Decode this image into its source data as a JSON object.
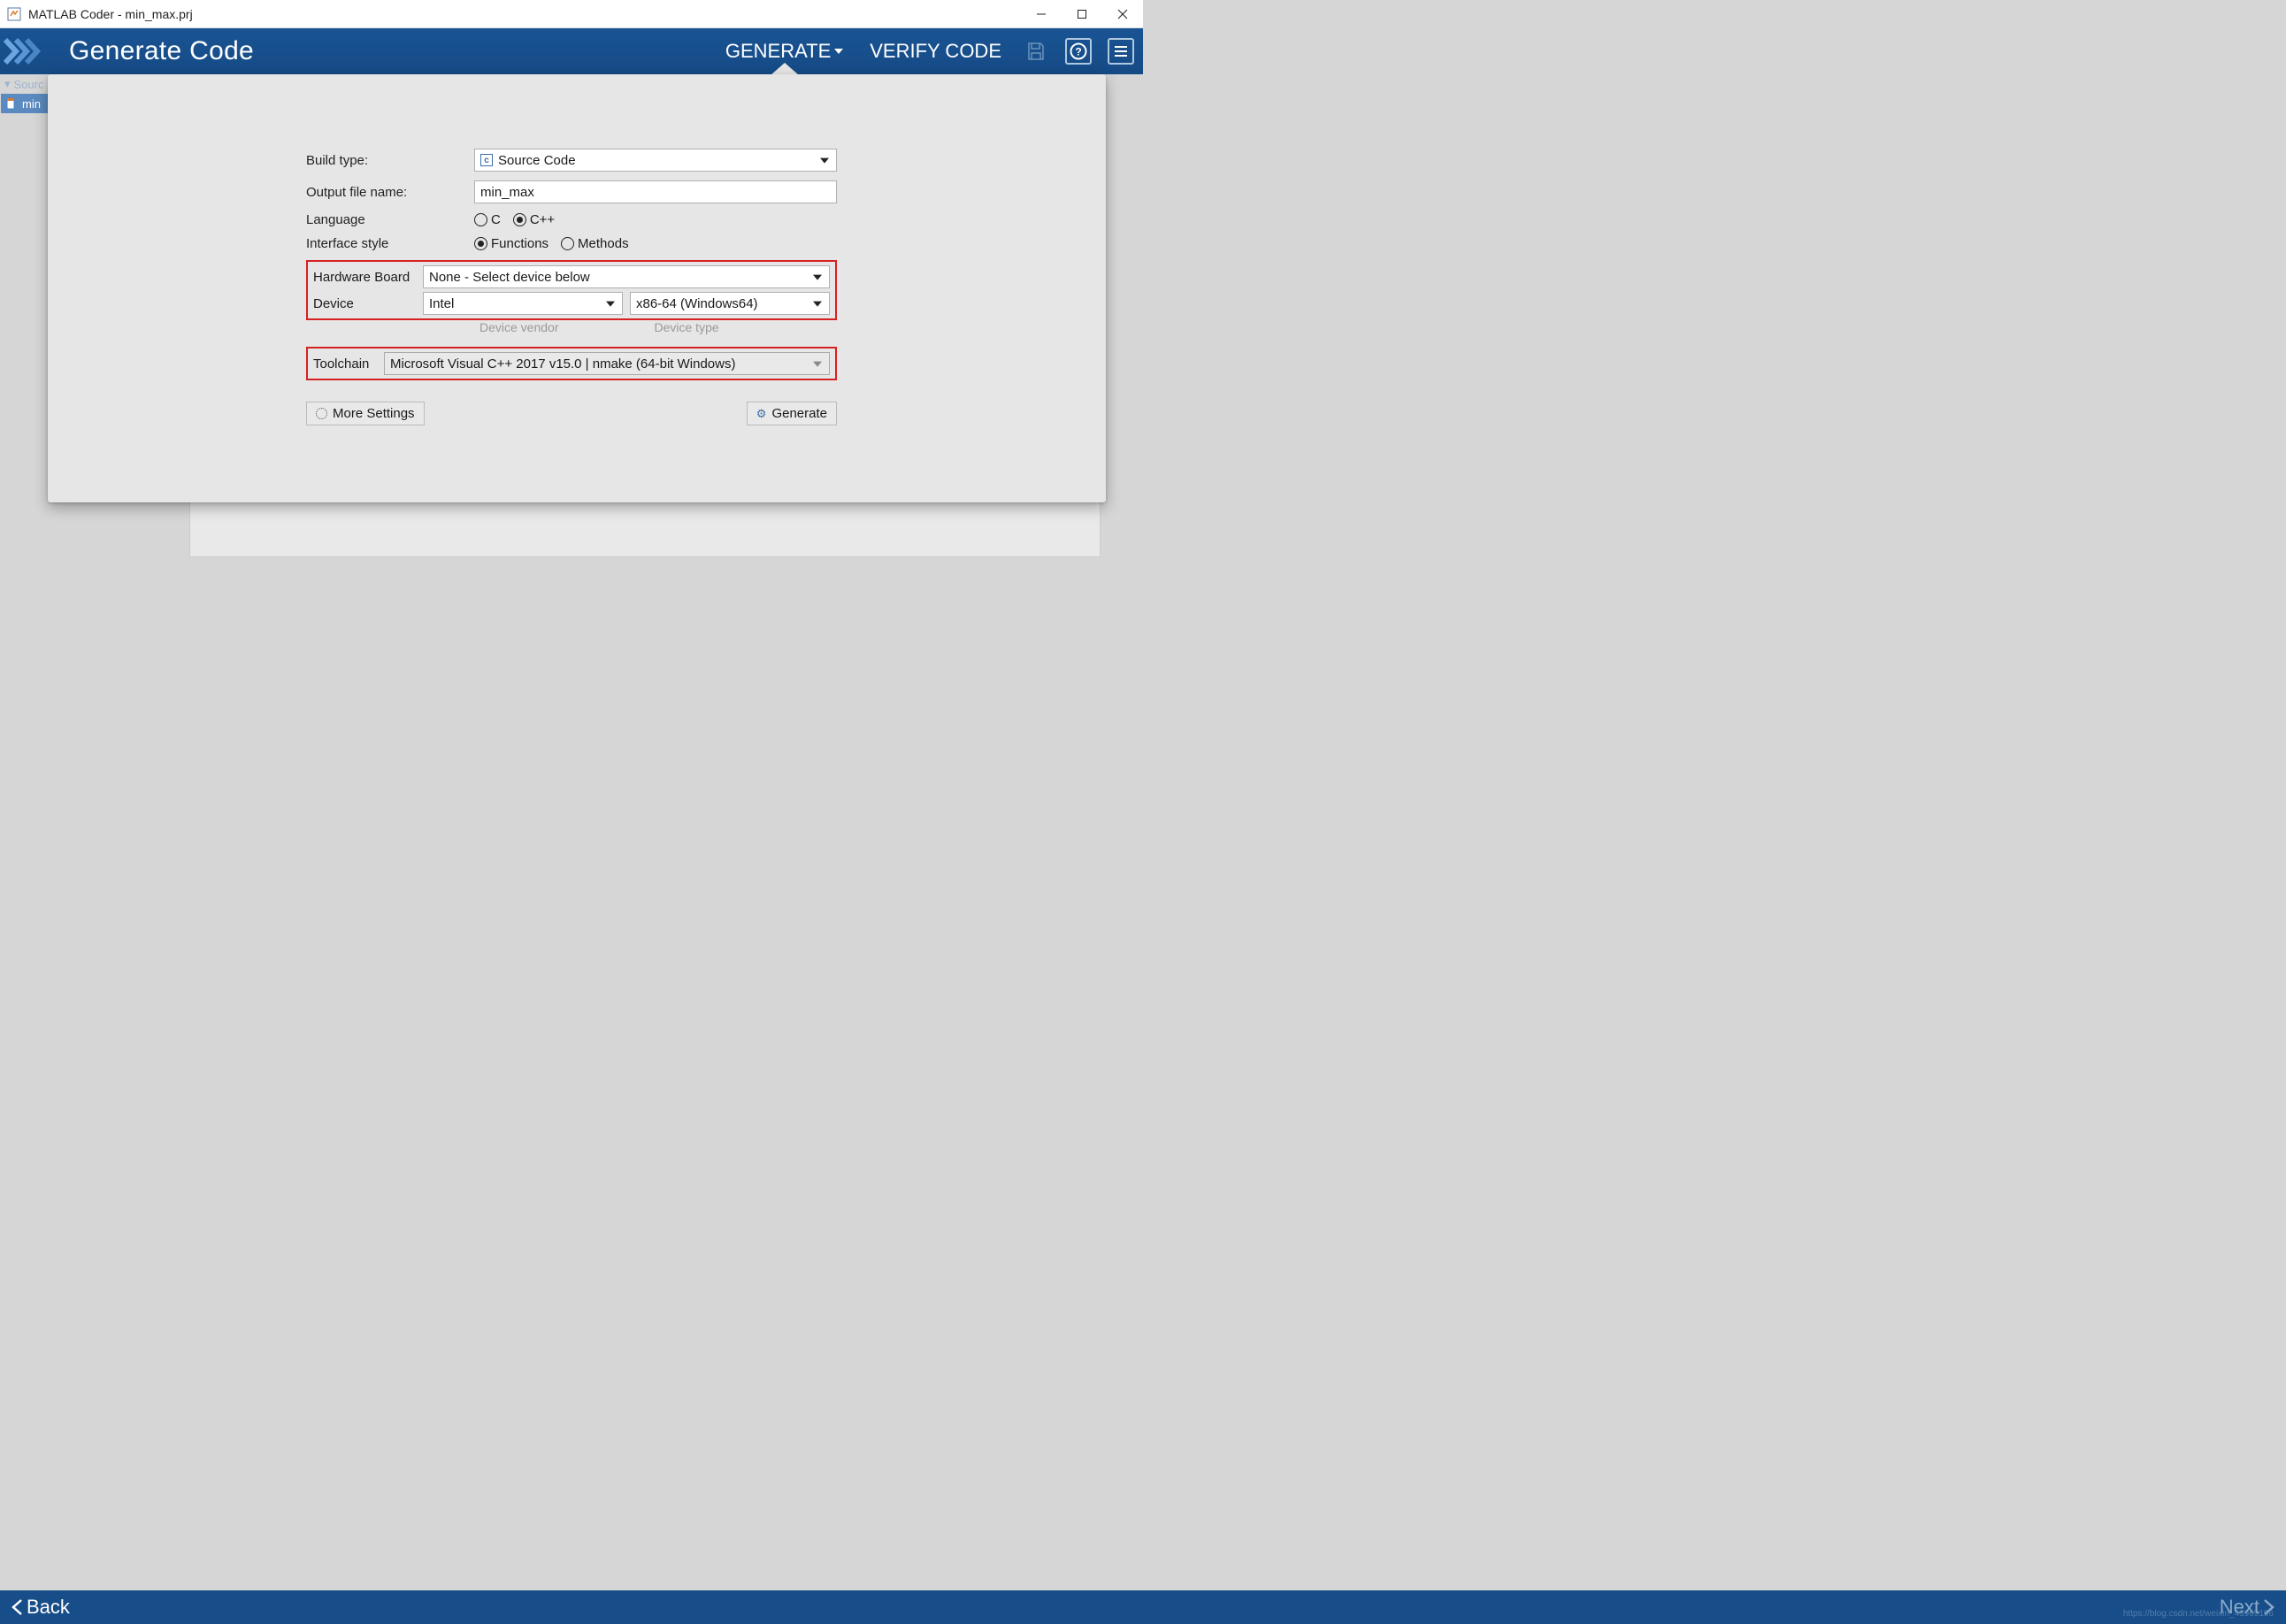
{
  "window": {
    "title": "MATLAB Coder - min_max.prj"
  },
  "header": {
    "page_title": "Generate Code",
    "generate_label": "GENERATE",
    "verify_label": "VERIFY CODE"
  },
  "sidebar": {
    "items": [
      {
        "label": "Sourc"
      },
      {
        "label": "min"
      }
    ]
  },
  "form": {
    "build_type_label": "Build type:",
    "build_type_value": "Source Code",
    "output_file_label": "Output file name:",
    "output_file_value": "min_max",
    "language_label": "Language",
    "language_options": {
      "c": "C",
      "cpp": "C++"
    },
    "language_selected": "cpp",
    "interface_label": "Interface style",
    "interface_options": {
      "functions": "Functions",
      "methods": "Methods"
    },
    "interface_selected": "functions",
    "hw_board_label": "Hardware Board",
    "hw_board_value": "None - Select device below",
    "device_label": "Device",
    "device_vendor_value": "Intel",
    "device_type_value": "x86-64 (Windows64)",
    "device_vendor_hint": "Device vendor",
    "device_type_hint": "Device type",
    "toolchain_label": "Toolchain",
    "toolchain_value": "Microsoft Visual C++ 2017 v15.0 | nmake (64-bit Windows)"
  },
  "buttons": {
    "more_settings": "More Settings",
    "generate": "Generate"
  },
  "footer": {
    "back": "Back",
    "next": "Next",
    "watermark": "https://blog.csdn.net/weixin_43969196"
  }
}
